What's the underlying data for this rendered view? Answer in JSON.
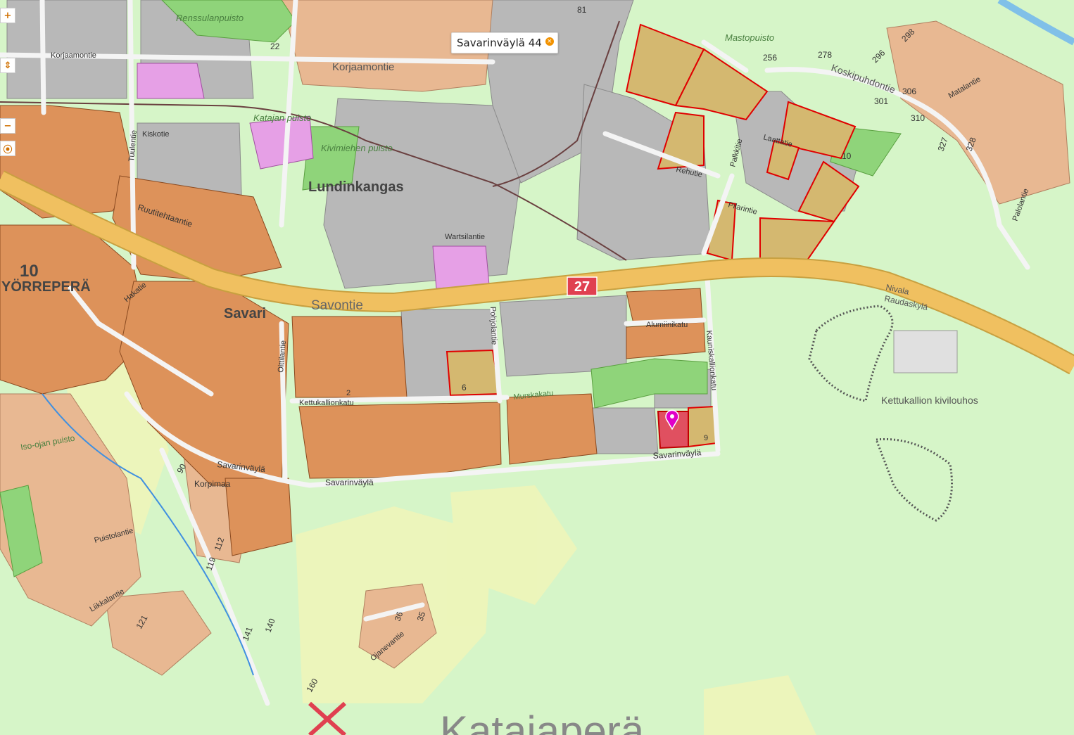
{
  "controls": {
    "zoom_in": "+",
    "pan": "⇕",
    "zoom_out": "−",
    "locate": "⦿"
  },
  "popup": {
    "address": "Savarinväylä 44",
    "close": "×"
  },
  "route_marker": "27",
  "colors": {
    "background": "#d6f5c8",
    "industrial": "#b8b8b8",
    "commercial": "#dd925a",
    "residential": "#e8b892",
    "park": "#8fd47a",
    "public": "#e6a0e6",
    "highway": "#f0c060",
    "highlight": "#d4b870",
    "selected_plot": "#e05060",
    "marker": "#e000c8"
  },
  "labels": {
    "lundinkangas": "Lundinkangas",
    "savari": "Savari",
    "savontie": "Savontie",
    "yorrepera": "YÖRREPERÄ",
    "district_10": "10",
    "katajapera": "Katajaperä",
    "renssulanpuisto": "Renssulanpuisto",
    "mastopuisto": "Mastopuisto",
    "katajan_puisto": "Katajan puisto",
    "kivimiehen_puisto": "Kivimiehen puisto",
    "korjaamontie_w": "Korjaamontie",
    "korjaamontie_e": "Korjaamontie",
    "koskipuhdontie": "Koskipuhdontie",
    "kiskotie": "Kiskotie",
    "ruutitehtaantie": "Ruutitehtaantie",
    "savarinvayla_n": "Savarinväylä",
    "savarinvayla_s": "Savarinväylä",
    "savarinvayla_e": "Savarinväylä",
    "kettukallionkatu": "Kettukallionkatu",
    "murskakatu": "Murskakatu",
    "alumiinikatu": "Alumiinikatu",
    "kauniskallionkatu": "Kauniskallionkatu",
    "pohjolantie": "Pohjolantie",
    "wartsilantie": "Wartsilantie",
    "rehutie": "Rehutie",
    "palkkitie": "Palkkitie",
    "pilarintie": "Pilarintie",
    "laattatie": "Laattatie",
    "korpimaa": "Korpimaa",
    "isoojan_puisto": "Iso-ojan puisto",
    "kettukallion_kivilouhos": "Kettukallion kivilouhos",
    "nivala": "Nivala",
    "raudaskyla": "Raudaskylä",
    "ojanevantie": "Ojanevantie",
    "palolantie": "Palolantie",
    "matalantie": "Matalantie",
    "tuulentie": "Tuulentie",
    "hakatie": "Hakatie",
    "oittilantie": "Oittilantie",
    "liikkalantie": "Liikkalantie",
    "puistolantie": "Puistolantie",
    "n256": "256",
    "n278": "278",
    "n296": "296",
    "n298": "298",
    "n301": "301",
    "n306": "306",
    "n310": "310",
    "n327": "327",
    "n328": "328",
    "n81": "81",
    "n90": "90",
    "n112": "112",
    "n119": "119",
    "n121": "121",
    "n140": "140",
    "n141": "141",
    "n160": "160",
    "n6": "6",
    "n9": "9",
    "n2": "2",
    "n10": "10",
    "n22": "22",
    "n35": "35",
    "n36": "36"
  }
}
